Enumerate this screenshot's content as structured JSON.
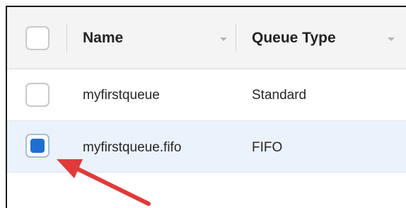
{
  "table": {
    "columns": [
      {
        "label": "Name",
        "sortable": true
      },
      {
        "label": "Queue Type",
        "sortable": true
      }
    ],
    "rows": [
      {
        "name": "myfirstqueue",
        "type": "Standard",
        "selected": false
      },
      {
        "name": "myfirstqueue.fifo",
        "type": "FIFO",
        "selected": true
      }
    ]
  },
  "colors": {
    "selected_row_bg": "#eaf2fb",
    "checkbox_checked": "#1e6fcf",
    "annotation_arrow": "#e03a3a"
  },
  "icons": {
    "sort": "chevron-down-icon",
    "annotation": "red-arrow-icon"
  }
}
